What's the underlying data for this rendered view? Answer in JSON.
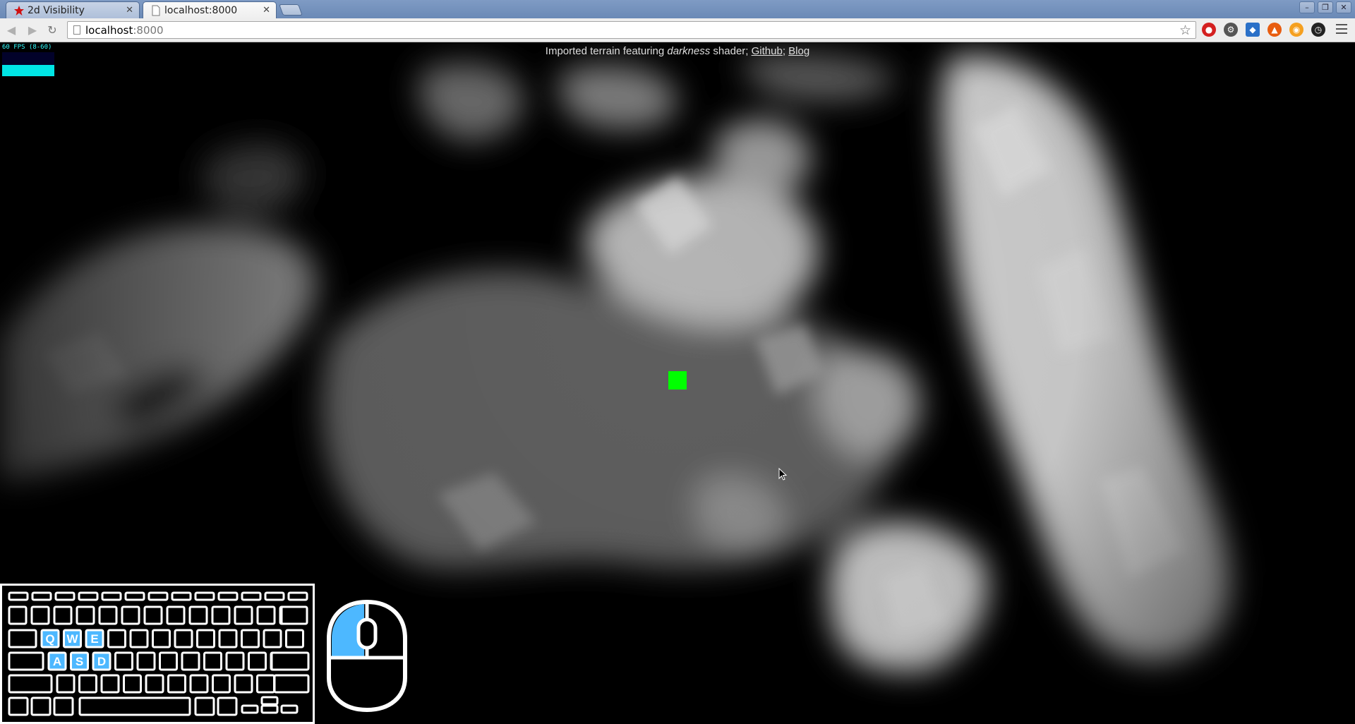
{
  "browser": {
    "tabs": [
      {
        "title": "2d Visibility",
        "active": false,
        "icon": "red-star-favicon"
      },
      {
        "title": "localhost:8000",
        "active": true,
        "icon": "page-icon"
      }
    ],
    "address": {
      "host": "localhost",
      "port": ":8000"
    },
    "window_controls": {
      "minimize": "–",
      "restore": "❐",
      "close": "✕"
    },
    "tab_close_glyph": "✕"
  },
  "page": {
    "caption_prefix": "Imported terrain featuring ",
    "caption_emphasis": "darkness",
    "caption_suffix": " shader; ",
    "link_github": "Github",
    "separator": ";",
    "link_blog": "Blog",
    "fps_text": "60 FPS (8-60)"
  },
  "keyboard": {
    "highlighted_keys": [
      "Q",
      "W",
      "E",
      "A",
      "S",
      "D"
    ],
    "highlight_color": "#4db8ff"
  },
  "mouse": {
    "highlighted_button": "left",
    "highlight_color": "#4db8ff"
  },
  "colors": {
    "player": "#00ff00",
    "fps_bar": "#00e5e5"
  }
}
